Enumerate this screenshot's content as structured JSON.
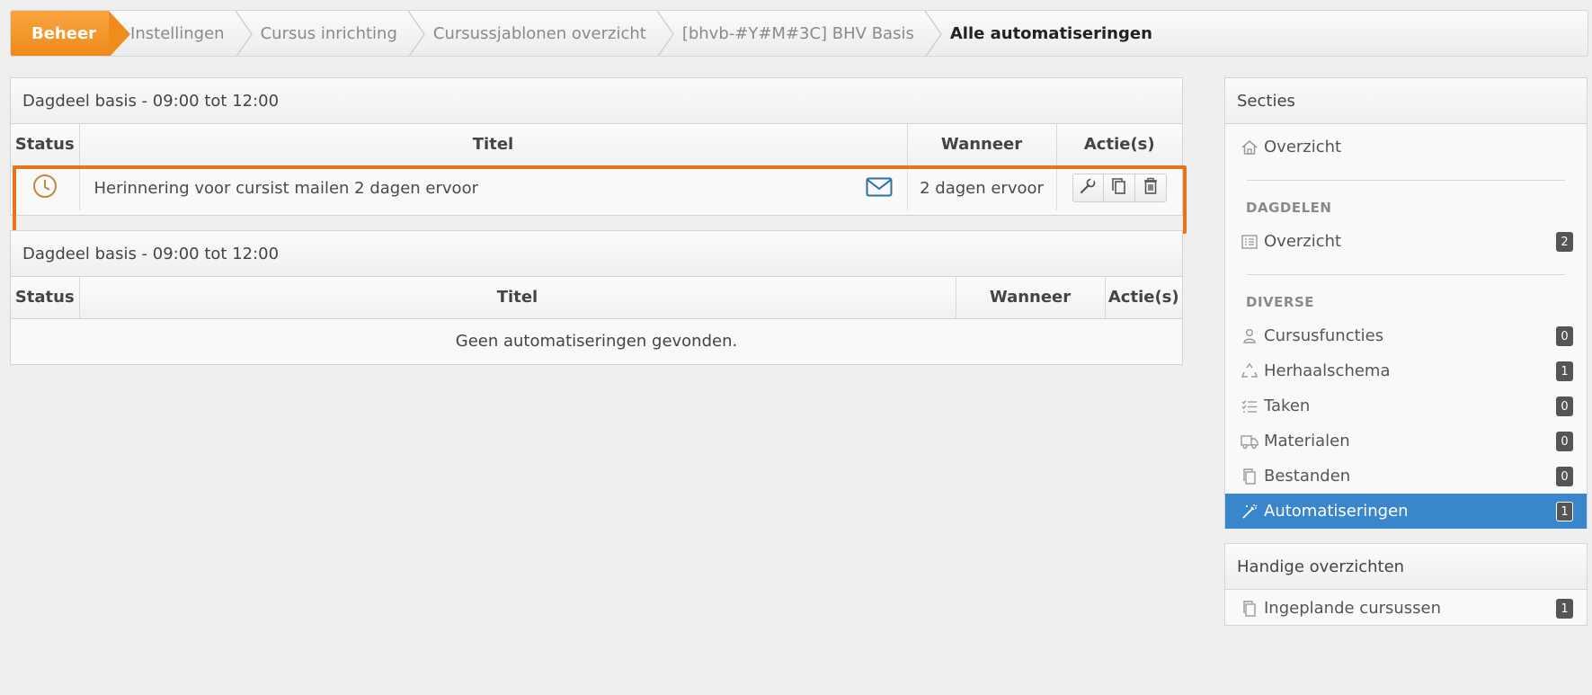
{
  "breadcrumb": {
    "home": "Beheer",
    "items": [
      "Instellingen",
      "Cursus inrichting",
      "Cursussjablonen overzicht",
      "[bhvb-#Y#M#3C] BHV Basis"
    ],
    "current": "Alle automatiseringen"
  },
  "tables": [
    {
      "title": "Dagdeel basis - 09:00 tot 12:00",
      "columns": [
        "Status",
        "Titel",
        "Wanneer",
        "Actie(s)"
      ],
      "rows": [
        {
          "status_icon": "clock-icon",
          "title": "Herinnering voor cursist mailen 2 dagen ervoor",
          "type_icon": "mail-icon",
          "when": "2 dagen ervoor",
          "actions": [
            "wrench-icon",
            "copy-icon",
            "trash-icon"
          ]
        }
      ]
    },
    {
      "title": "Dagdeel basis - 09:00 tot 12:00",
      "columns": [
        "Status",
        "Titel",
        "Wanneer",
        "Actie(s)"
      ],
      "empty_text": "Geen automatiseringen gevonden."
    }
  ],
  "sidebar": {
    "title": "Secties",
    "overview": {
      "label": "Overzicht",
      "icon": "home-icon"
    },
    "groups": [
      {
        "label": "DAGDELEN",
        "items": [
          {
            "label": "Overzicht",
            "count": "2",
            "icon": "list-icon"
          }
        ]
      },
      {
        "label": "DIVERSE",
        "items": [
          {
            "label": "Cursusfuncties",
            "count": "0",
            "icon": "users-icon"
          },
          {
            "label": "Herhaalschema",
            "count": "1",
            "icon": "recycle-icon"
          },
          {
            "label": "Taken",
            "count": "0",
            "icon": "tasks-icon"
          },
          {
            "label": "Materialen",
            "count": "0",
            "icon": "truck-icon"
          },
          {
            "label": "Bestanden",
            "count": "0",
            "icon": "files-icon"
          },
          {
            "label": "Automatiseringen",
            "count": "1",
            "icon": "magic-wand-icon",
            "active": true
          }
        ]
      }
    ]
  },
  "handy": {
    "title": "Handige overzichten",
    "items": [
      {
        "label": "Ingeplande cursussen",
        "count": "1",
        "icon": "files-icon"
      }
    ]
  },
  "colors": {
    "accent_orange": "#ee8a1a",
    "active_blue": "#3a86cc",
    "highlight": "#e8731c",
    "clock": "#c08a3a",
    "mail": "#2a6fa8"
  }
}
